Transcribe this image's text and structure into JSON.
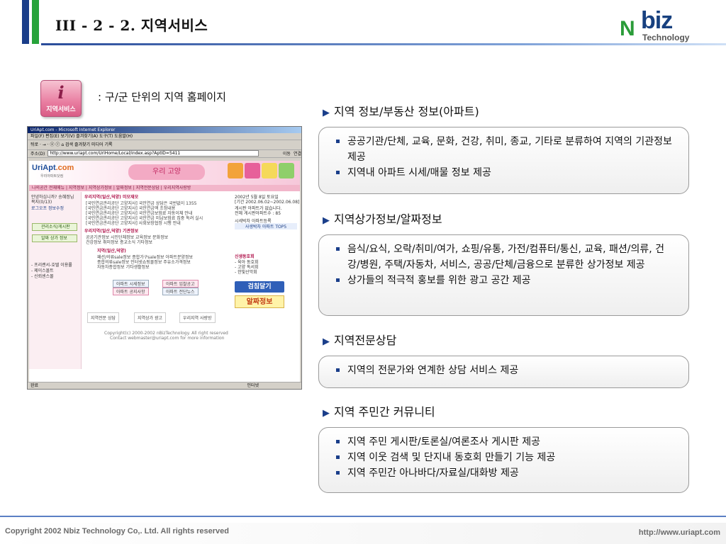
{
  "header": {
    "title": "III - 2 - 2. 지역서비스",
    "logo_n": "N",
    "logo_biz": "biz",
    "logo_tech": "Technology"
  },
  "badge": {
    "icon_letter": "i",
    "label": "지역서비스"
  },
  "intro": ": 구/군 단위의 지역 홈페이지",
  "screenshot": {
    "window_title": "UriApt.com - Microsoft Internet Explorer",
    "menu": "파일(F)   편집(E)   보기(V)   즐겨찾기(A)   도구(T)   도움말(H)",
    "toolbar": "뒤로 ·  →  ·  ⓧ  ⓡ  ⌂    검색   즐겨찾기   미디어   기록",
    "address_label": "주소(D)",
    "address_value": "http://www.uriapt.com/UriHome/Local/index.asp?AptID=5411",
    "go_label": "이동",
    "links_label": "연결",
    "site_logo": "UriApt",
    "site_logo_suffix": ".com",
    "site_logo_sub": "우리아파트닷컴",
    "site_banner": "우리 고양",
    "nav": "나의공간  전체메뉴  |  지역정보  |  지역상가정보  |  알짜정보  |  지역전문상담  |  우리지역사랑방",
    "left_lines": [
      "안녕하십니까? 송혜정님",
      "복지(0/13)"
    ],
    "left_btn1": "로그오프  정보수정",
    "left_menu1": "관리소식/게시판",
    "left_menu2": "알짜 상가 정보",
    "left_links": [
      "- 프리랜서-호텔 이용률",
      "- 제이스몰트",
      "- 신뢰센스몰"
    ],
    "mid_sec1": "우리지역(일산,덕양) 미모재모",
    "mid_sec1_lines": [
      "[국민연금관리공단 고양지사] 국민연금 상담은 국번없이 1355",
      "[국민연금관리공단 고양지사] 국민연금액 조정내용",
      "[국민연금관리공단 고양지사] 국민연금보험료 자동이체 안내",
      "[국민연금관리공단 고양지사] 국민연금 미납보험료 집중 독려 실시",
      "[국민연금관리공단 고양지사] 사회보장협정 시행 안내"
    ],
    "mid_sec2": "우리지역(일산,덕양) 기관정보",
    "mid_sec2_lines": [
      "공공기관정보   시민단체정보   교육정보   문화정보",
      "건강정보   취미정보   종교소식   기타정보"
    ],
    "mid_sec3": "지역(일산,덕양)",
    "mid_sec3_lines": [
      "패션/의류sale정보   종합가구sale정보   아파트분양정보",
      "종합의류sale정보   인터넷쇼핑몰정보   주유소가격정보",
      "자동차종합정보   기타생활정보"
    ],
    "mid_tabs": [
      "아파트 시세정보",
      "아파트 입찰공고",
      "아파트 공지사항",
      "아파트 전단뉴스"
    ],
    "bottom_tabs": [
      "지역전문 상담",
      "지역상가 광고",
      "우리지역 사랑방"
    ],
    "right_lines": [
      "2002년 5월 8일 토요일",
      "[기간 2002.06.02~2002.06.08]",
      "게시판 아파트가 없습니다.",
      "전체 게시판아파트수 : 85",
      "시세박차 아파트등록",
      "사생박차 아파트 TOP5",
      "신생동호회",
      "- 육아 동호회",
      "- 고양 독서회",
      "- 한빛산악회"
    ],
    "right_banner1": "검침달기",
    "right_banner2": "알짜정보",
    "copyright1": "Copyright(c) 2000-2002 nBizTechnology.  All right reserved",
    "copyright2": "Contact webmaster@uriapt.com for more information",
    "status_left": "완료",
    "status_right": "인터넷"
  },
  "sections": [
    {
      "title": "지역 정보/부동산 정보(아파트)",
      "items": [
        "공공기관/단체, 교육, 문화, 건강, 취미, 종교, 기타로 분류하여 지역의 기관정보 제공",
        "지역내 아파트 시세/매물 정보 제공"
      ]
    },
    {
      "title": "지역상가정보/알짜정보",
      "items": [
        "음식/요식, 오락/취미/여가, 쇼핑/유통, 가전/컴퓨터/통신, 교육, 패션/의류, 건강/병원, 주택/자동차, 서비스, 공공/단체/금융으로 분류한 상가정보 제공",
        "상가들의 적극적 홍보를 위한 광고 공간 제공"
      ]
    },
    {
      "title": "지역전문상담",
      "items": [
        "지역의 전문가와 연계한 상담 서비스 제공"
      ]
    },
    {
      "title": "지역 주민간 커뮤니티",
      "items": [
        "지역 주민 게시판/토론실/여론조사 게시판 제공",
        "지역 이웃 검색 및 단지내 동호회 만들기 기능 제공",
        "지역 주민간 아나바다/자료실/대화방 제공"
      ]
    }
  ],
  "footer": {
    "copyright": "Copyright 2002 Nbiz Technology Co,. Ltd. All rights reserved",
    "url": "http://www.uriapt.com"
  }
}
